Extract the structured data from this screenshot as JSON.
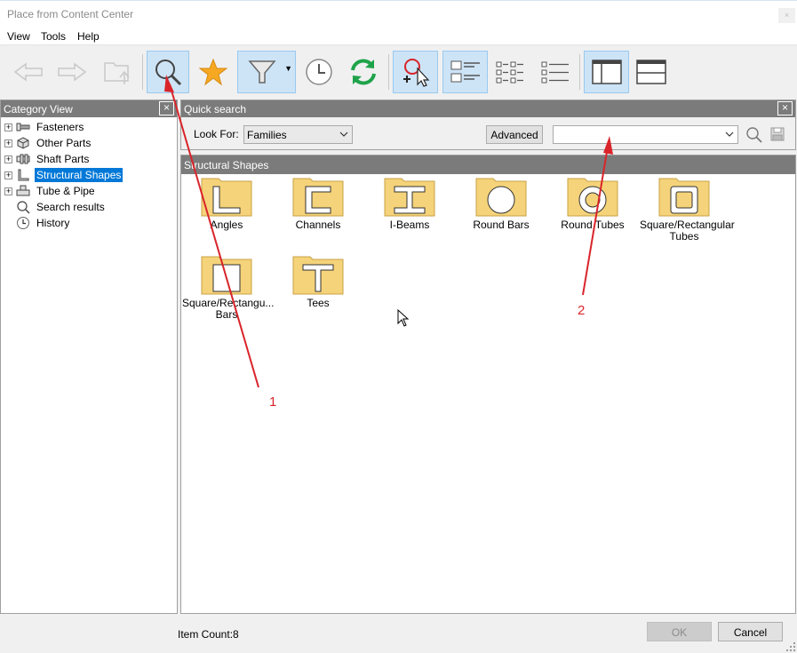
{
  "window": {
    "title": "Place from Content Center",
    "close_glyph": "×"
  },
  "menu": [
    "View",
    "Tools",
    "Help"
  ],
  "toolbar": {
    "buttons": [
      "back-arrow-icon",
      "forward-arrow-icon",
      "up-folder-icon",
      "search-icon",
      "favorites-star-icon",
      "filter-icon",
      "history-clock-icon",
      "refresh-icon",
      "add-to-search-icon",
      "view-details-icon",
      "view-small-icons-icon",
      "view-list-icon",
      "tree-pane-icon",
      "preview-pane-icon"
    ]
  },
  "left_panel": {
    "title": "Category View",
    "close_glyph": "×",
    "tree": [
      {
        "label": "Fasteners",
        "icon": "fasteners-icon",
        "expandable": true
      },
      {
        "label": "Other Parts",
        "icon": "other-parts-icon",
        "expandable": true
      },
      {
        "label": "Shaft Parts",
        "icon": "shaft-parts-icon",
        "expandable": true
      },
      {
        "label": "Structural Shapes",
        "icon": "structural-shapes-icon",
        "expandable": true,
        "selected": true
      },
      {
        "label": "Tube & Pipe",
        "icon": "tube-pipe-icon",
        "expandable": true
      },
      {
        "label": "Search results",
        "icon": "search-icon",
        "expandable": false
      },
      {
        "label": "History",
        "icon": "history-clock-icon",
        "expandable": false
      }
    ]
  },
  "quick_search": {
    "title": "Quick search",
    "close_glyph": "×",
    "look_for_label": "Look For:",
    "look_for_value": "Families",
    "advanced_label": "Advanced",
    "search_value": ""
  },
  "content": {
    "header": "Structural Shapes",
    "folders": [
      {
        "label": "Angles",
        "icon": "angle-profile-icon"
      },
      {
        "label": "Channels",
        "icon": "channel-profile-icon"
      },
      {
        "label": "I-Beams",
        "icon": "i-beam-profile-icon"
      },
      {
        "label": "Round Bars",
        "icon": "round-bar-profile-icon"
      },
      {
        "label": "Round Tubes",
        "icon": "round-tube-profile-icon"
      },
      {
        "label": "Square/Rectangular Tubes",
        "icon": "square-tube-profile-icon"
      },
      {
        "label": "Square/Rectangu... Bars",
        "icon": "square-bar-profile-icon"
      },
      {
        "label": "Tees",
        "icon": "tee-profile-icon"
      }
    ]
  },
  "status": {
    "item_count": "Item Count:8"
  },
  "buttons": {
    "ok": "OK",
    "cancel": "Cancel"
  },
  "annotations": {
    "label_1": "1",
    "label_2": "2",
    "color": "#d9242a"
  },
  "colors": {
    "folder_fill": "#f5d37a",
    "folder_border": "#c9a044",
    "selection": "#0078d7",
    "header_gray": "#7b7b7b"
  }
}
